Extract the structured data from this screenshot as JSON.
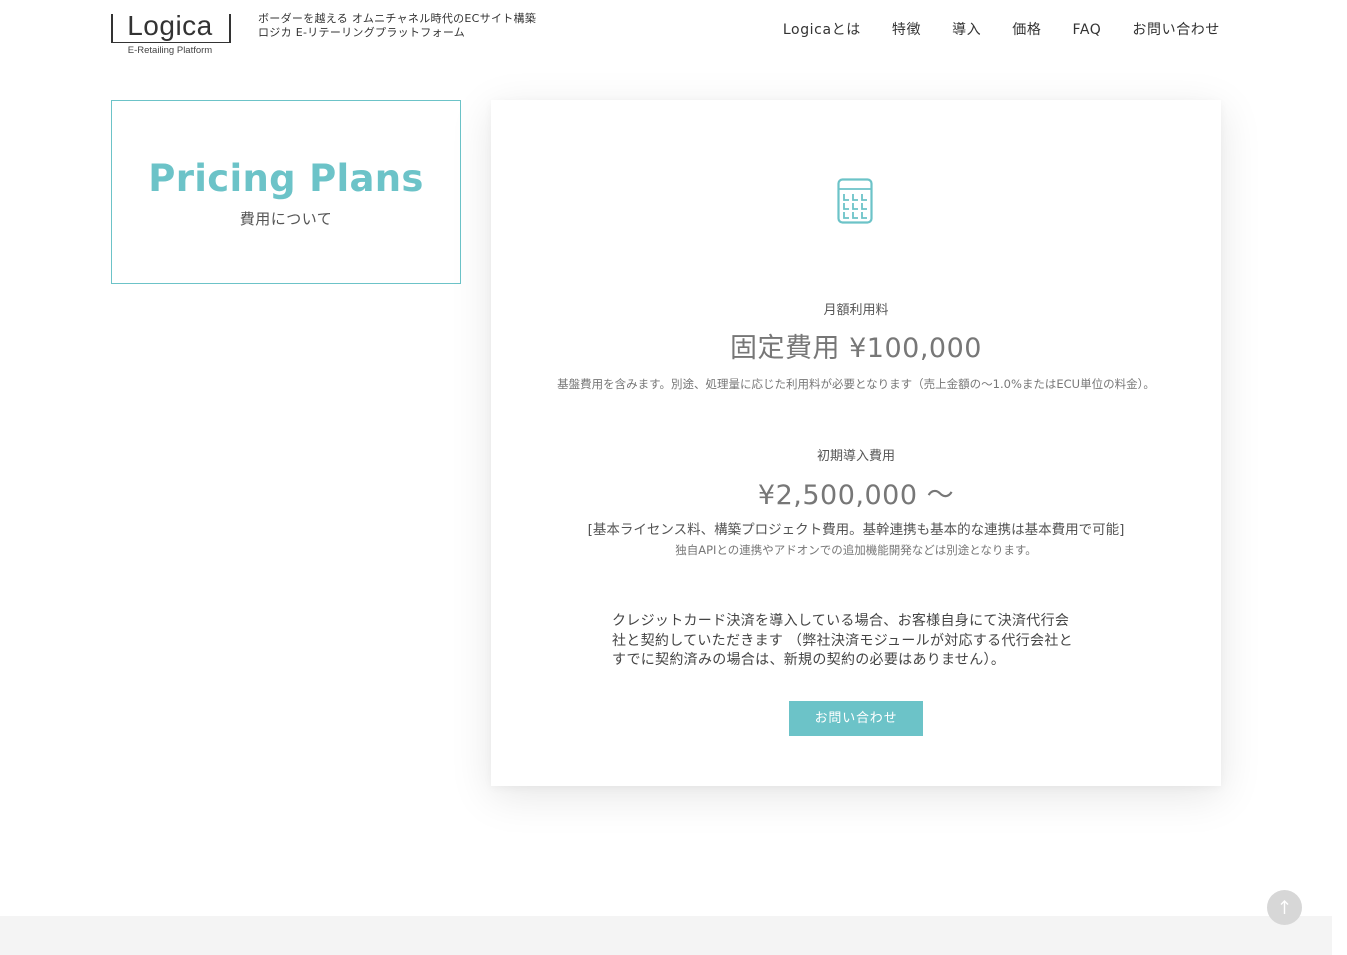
{
  "header": {
    "logo": {
      "wordmark": "Logica",
      "subtitle": "E-Retailing Platform"
    },
    "tagline": {
      "line1": "ボーダーを越える オムニチャネル時代のECサイト構築",
      "line2": "ロジカ E-リテーリングプラットフォーム"
    },
    "nav": [
      {
        "label": "Logicaとは"
      },
      {
        "label": "特徴"
      },
      {
        "label": "導入"
      },
      {
        "label": "価格"
      },
      {
        "label": "FAQ"
      },
      {
        "label": "お問い合わせ"
      }
    ]
  },
  "title_box": {
    "title": "Pricing Plans",
    "subtitle": "費用について"
  },
  "pricing": {
    "icon": "calculator-icon",
    "monthly": {
      "label": "月額利用料",
      "price": "固定費用 ¥100,000",
      "note": "基盤費用を含みます。別途、処理量に応じた利用料が必要となります（売上金額の〜1.0%またはECU単位の料金）。"
    },
    "initial": {
      "label": "初期導入費用",
      "price": "¥2,500,000 〜",
      "note_main": "[基本ライセンス料、構築プロジェクト費用。基幹連携も基本的な連携は基本費用で可能]",
      "note_sub": "独自APIとの連携やアドオンでの追加機能開発などは別途となります。"
    },
    "payment_note": {
      "line1": "クレジットカード決済を導入している場合、お客様自身にて決済代行会",
      "line2": "社と契約していただきます （弊社決済モジュールが対応する代行会社と",
      "line3": "すでに契約済みの場合は、新規の契約の必要はありません）。"
    },
    "contact_button": "お問い合わせ"
  },
  "scroll_top_icon": "arrow-up-icon",
  "colors": {
    "accent": "#6cc3c8",
    "text": "#555555",
    "footer_bg": "#f4f4f4",
    "scroll_btn": "#d7d7d7"
  }
}
